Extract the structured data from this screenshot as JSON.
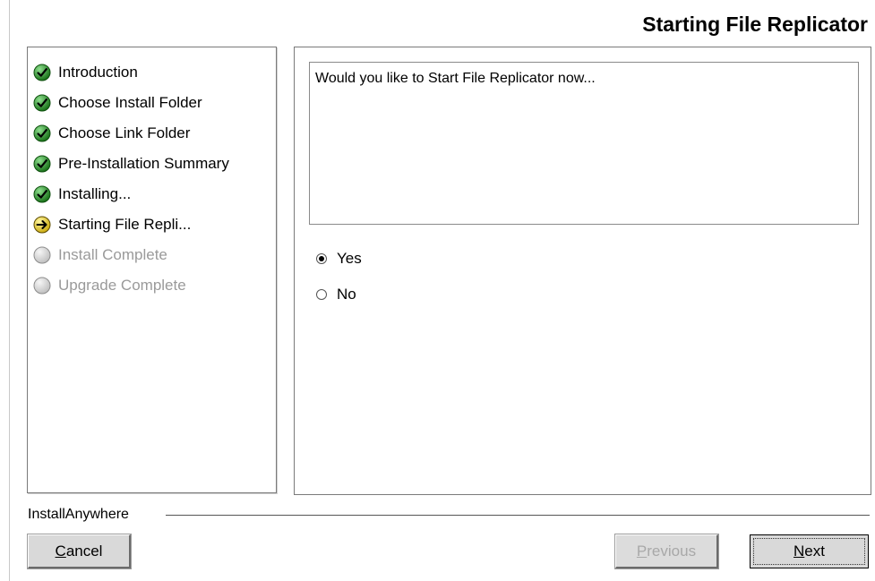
{
  "header": {
    "title": "Starting File Replicator"
  },
  "steps": [
    {
      "label": "Introduction",
      "status": "complete",
      "icon": "check-icon"
    },
    {
      "label": "Choose Install Folder",
      "status": "complete",
      "icon": "check-icon"
    },
    {
      "label": "Choose Link Folder",
      "status": "complete",
      "icon": "check-icon"
    },
    {
      "label": "Pre-Installation Summary",
      "status": "complete",
      "icon": "check-icon"
    },
    {
      "label": "Installing...",
      "status": "complete",
      "icon": "check-icon"
    },
    {
      "label": "Starting File Repli...",
      "status": "current",
      "icon": "arrow-right-icon"
    },
    {
      "label": "Install Complete",
      "status": "pending",
      "icon": "empty-circle-icon"
    },
    {
      "label": "Upgrade Complete",
      "status": "pending",
      "icon": "empty-circle-icon"
    }
  ],
  "content": {
    "question": "Would you like to Start File Replicator now...",
    "options": [
      {
        "label": "Yes",
        "selected": true
      },
      {
        "label": "No",
        "selected": false
      }
    ]
  },
  "footer": {
    "brand": "InstallAnywhere",
    "cancel_label": "Cancel",
    "previous_label": "Previous",
    "next_label": "Next"
  },
  "colors": {
    "complete_icon": "#1c8a1c",
    "current_icon": "#e8d22a",
    "pending_icon": "#d8d8d8",
    "button_face": "#d9d9d9"
  }
}
